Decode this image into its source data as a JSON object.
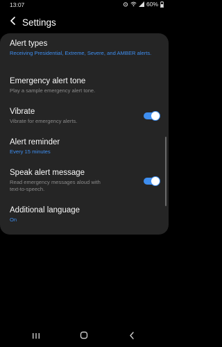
{
  "status_bar": {
    "time": "13:07",
    "battery": "60%",
    "icons": [
      "alarm-icon",
      "wifi-icon",
      "signal-icon",
      "battery-icon"
    ]
  },
  "header": {
    "title": "Settings",
    "back_icon": "chevron-left-icon"
  },
  "settings": {
    "alert_types": {
      "title": "Alert types",
      "subtitle": "Receiving Presidential, Extreme, Severe, and AMBER alerts."
    },
    "emergency_tone": {
      "title": "Emergency alert tone",
      "subtitle": "Play a sample emergency alert tone."
    },
    "vibrate": {
      "title": "Vibrate",
      "subtitle": "Vibrate for emergency alerts.",
      "enabled": true
    },
    "alert_reminder": {
      "title": "Alert reminder",
      "subtitle": "Every 15 minutes"
    },
    "speak_alert": {
      "title": "Speak alert message",
      "subtitle_line1": "Read emergency messages aloud with",
      "subtitle_line2": "text-to-speech.",
      "enabled": true
    },
    "additional_language": {
      "title": "Additional language",
      "subtitle": "On"
    }
  },
  "navbar": {
    "buttons": [
      "recent-apps-icon",
      "home-icon",
      "back-icon"
    ]
  },
  "colors": {
    "accent": "#3e8ef0",
    "card": "#252525",
    "background": "#000000",
    "subtitle_grey": "#8a8a8a"
  }
}
